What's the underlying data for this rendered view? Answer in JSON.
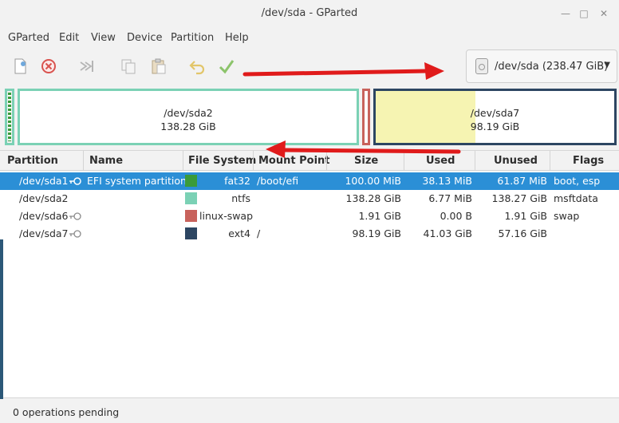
{
  "window": {
    "title": "/dev/sda - GParted"
  },
  "menu": [
    "GParted",
    "Edit",
    "View",
    "Device",
    "Partition",
    "Help"
  ],
  "toolbar": {
    "icons": [
      "new-partition-icon",
      "delete-icon",
      "resize-move-icon",
      "copy-icon",
      "paste-icon",
      "undo-icon",
      "apply-icon"
    ],
    "device_select": {
      "value": "/dev/sda  (238.47 GiB)"
    }
  },
  "diskmap": [
    {
      "name": "/dev/sda1",
      "size": "",
      "color": "#3a9b3a"
    },
    {
      "name": "/dev/sda2",
      "size": "138.28 GiB",
      "color": "#7bd1b5"
    },
    {
      "name": "/dev/sda6",
      "size": "",
      "color": "#c8625c"
    },
    {
      "name": "/dev/sda7",
      "size": "98.19 GiB",
      "color": "#2d4662",
      "used_fraction": 0.42
    }
  ],
  "table": {
    "columns": [
      "Partition",
      "Name",
      "File System",
      "Mount Point",
      "Size",
      "Used",
      "Unused",
      "Flags"
    ],
    "rows": [
      {
        "partition": "/dev/sda1",
        "icon": "key-icon",
        "name": "EFI system partition",
        "fs": "fat32",
        "fs_color": "#3a9b3a",
        "mount": "/boot/efi",
        "size": "100.00 MiB",
        "used": "38.13 MiB",
        "unused": "61.87 MiB",
        "flags": "boot, esp",
        "selected": true
      },
      {
        "partition": "/dev/sda2",
        "icon": "",
        "name": "",
        "fs": "ntfs",
        "fs_color": "#7bd1b5",
        "mount": "",
        "size": "138.28 GiB",
        "used": "6.77 MiB",
        "unused": "138.27 GiB",
        "flags": "msftdata",
        "selected": false
      },
      {
        "partition": "/dev/sda6",
        "icon": "key-icon",
        "name": "",
        "fs": "linux-swap",
        "fs_color": "#c8625c",
        "mount": "",
        "size": "1.91 GiB",
        "used": "0.00 B",
        "unused": "1.91 GiB",
        "flags": "swap",
        "selected": false
      },
      {
        "partition": "/dev/sda7",
        "icon": "key-icon",
        "name": "",
        "fs": "ext4",
        "fs_color": "#2d4662",
        "mount": "/",
        "size": "98.19 GiB",
        "used": "41.03 GiB",
        "unused": "57.16 GiB",
        "flags": "",
        "selected": false
      }
    ]
  },
  "status": {
    "text": "0 operations pending"
  },
  "colors": {
    "selection": "#2b8fd6",
    "annotation_arrow": "#e01b1b"
  }
}
